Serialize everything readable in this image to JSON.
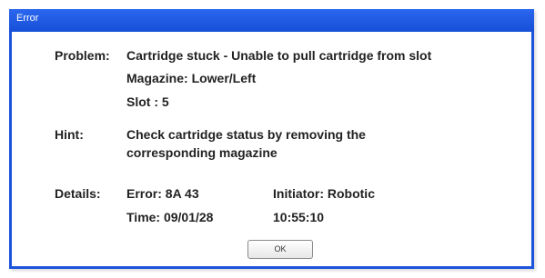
{
  "window": {
    "title": "Error"
  },
  "problem": {
    "label": "Problem:",
    "text": "Cartridge stuck - Unable to pull cartridge from slot",
    "magazine": "Magazine: Lower/Left",
    "slot": "Slot : 5"
  },
  "hint": {
    "label": "Hint:",
    "line1": "Check cartridge status by removing the",
    "line2": "corresponding magazine"
  },
  "details": {
    "label": "Details:",
    "error": "Error: 8A 43",
    "initiator": "Initiator: Robotic",
    "time": "Time:  09/01/28",
    "clock": "10:55:10"
  },
  "buttons": {
    "ok_label": "OK"
  },
  "colors": {
    "titlebar": "#1d54dc",
    "title_text": "#ffffff",
    "body_text": "#222222"
  }
}
